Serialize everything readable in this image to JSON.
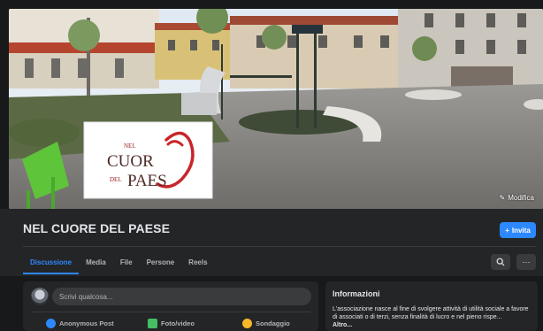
{
  "cover": {
    "logo_lines": [
      "NEL",
      "CUOR",
      "DEL",
      "PAES"
    ],
    "edit_label": "Modifica"
  },
  "group": {
    "title": "NEL CUORE DEL PAESE",
    "invite_label": "Invita"
  },
  "tabs": [
    {
      "label": "Discussione",
      "active": true
    },
    {
      "label": "Media"
    },
    {
      "label": "File"
    },
    {
      "label": "Persone"
    },
    {
      "label": "Reels"
    }
  ],
  "tab_tools": {
    "search_icon": "search-icon",
    "more_label": "···"
  },
  "composer": {
    "placeholder": "Scrivi qualcosa...",
    "actions": [
      {
        "label": "Anonymous Post",
        "icon": "anonymous-post-icon",
        "color": "#2d88ff"
      },
      {
        "label": "Foto/video",
        "icon": "photo-video-icon",
        "color": "#45bd62"
      },
      {
        "label": "Sondaggio",
        "icon": "poll-icon",
        "color": "#f7b928"
      }
    ]
  },
  "info": {
    "title": "Informazioni",
    "text": "L'associazione nasce al fine di svolgere attività di utilità sociale a favore di associati o di terzi, senza finalità di lucro e nel pieno rispe...",
    "more_label": "Altro..."
  },
  "colors": {
    "accent": "#2d88ff",
    "background": "#18191a",
    "surface": "#242526"
  }
}
